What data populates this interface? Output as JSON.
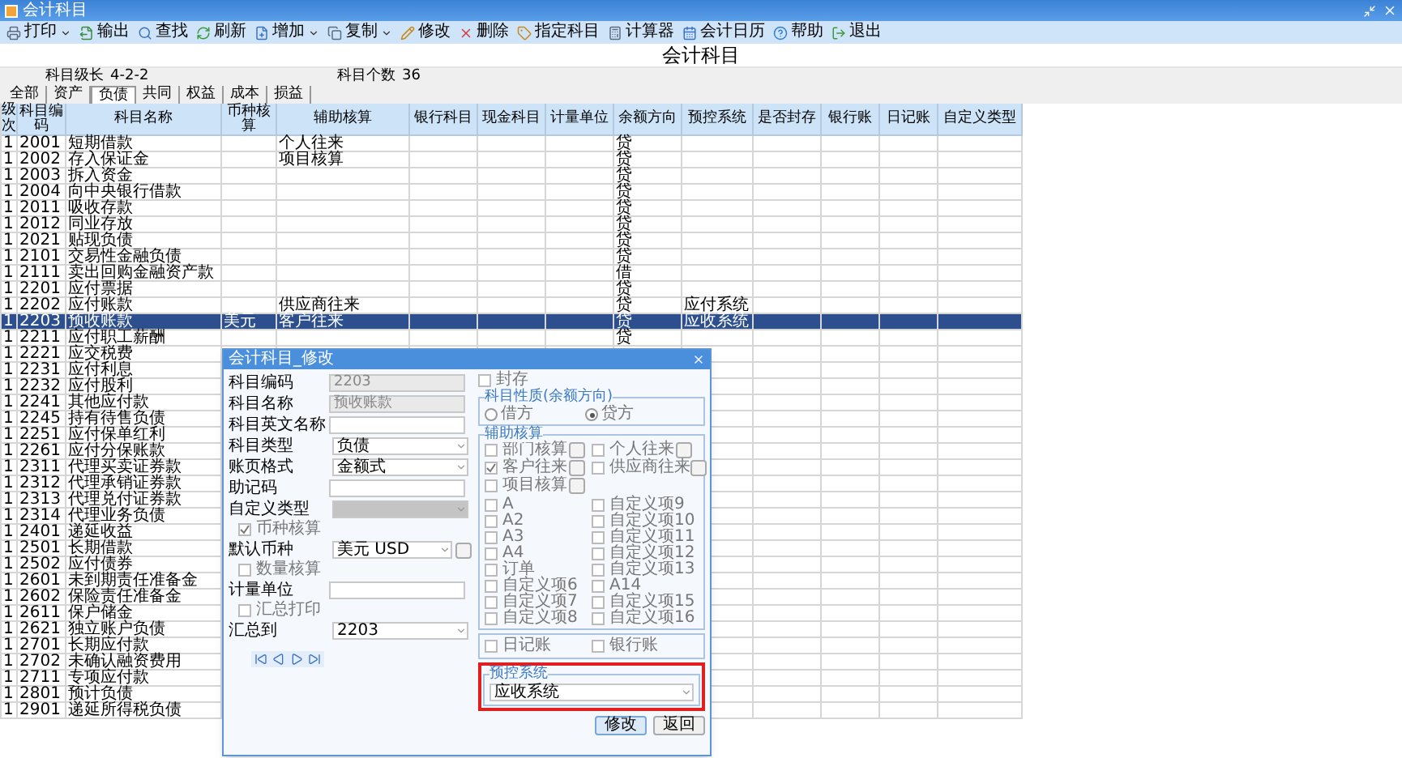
{
  "window": {
    "title": "会计科目"
  },
  "toolbar": [
    {
      "label": "打印",
      "dropdown": true
    },
    {
      "label": "输出",
      "dropdown": false
    },
    {
      "label": "查找",
      "dropdown": false
    },
    {
      "label": "刷新",
      "dropdown": false
    },
    {
      "label": "增加",
      "dropdown": true
    },
    {
      "label": "复制",
      "dropdown": true
    },
    {
      "label": "修改",
      "dropdown": false
    },
    {
      "label": "删除",
      "dropdown": false
    },
    {
      "label": "指定科目",
      "dropdown": false
    },
    {
      "label": "计算器",
      "dropdown": false
    },
    {
      "label": "会计日历",
      "dropdown": false
    },
    {
      "label": "帮助",
      "dropdown": false
    },
    {
      "label": "退出",
      "dropdown": false
    }
  ],
  "heading": "会计科目",
  "info": [
    {
      "label": "科目级长",
      "value": "4-2-2"
    },
    {
      "label": "科目个数",
      "value": "36"
    }
  ],
  "tabs": [
    {
      "label": "全部",
      "selected": false
    },
    {
      "label": "资产",
      "selected": false
    },
    {
      "label": "负债",
      "selected": true
    },
    {
      "label": "共同",
      "selected": false
    },
    {
      "label": "权益",
      "selected": false
    },
    {
      "label": "成本",
      "selected": false
    },
    {
      "label": "损益",
      "selected": false
    }
  ],
  "table": {
    "columns": [
      "级次",
      "科目编码",
      "科目名称",
      "币种核算",
      "辅助核算",
      "银行科目",
      "现金科目",
      "计量单位",
      "余额方向",
      "预控系统",
      "是否封存",
      "银行账",
      "日记账",
      "自定义类型"
    ],
    "rows": [
      {
        "level": "1",
        "code": "2001",
        "name": "短期借款",
        "auxiliary": "个人往来",
        "direction": "贷",
        "selected": false
      },
      {
        "level": "1",
        "code": "2002",
        "name": "存入保证金",
        "auxiliary": "项目核算",
        "direction": "贷",
        "selected": false
      },
      {
        "level": "1",
        "code": "2003",
        "name": "拆入资金",
        "direction": "贷",
        "selected": false
      },
      {
        "level": "1",
        "code": "2004",
        "name": "向中央银行借款",
        "direction": "贷",
        "selected": false
      },
      {
        "level": "1",
        "code": "2011",
        "name": "吸收存款",
        "direction": "贷",
        "selected": false
      },
      {
        "level": "1",
        "code": "2012",
        "name": "同业存放",
        "direction": "贷",
        "selected": false
      },
      {
        "level": "1",
        "code": "2021",
        "name": "贴现负债",
        "direction": "贷",
        "selected": false
      },
      {
        "level": "1",
        "code": "2101",
        "name": "交易性金融负债",
        "direction": "贷",
        "selected": false
      },
      {
        "level": "1",
        "code": "2111",
        "name": "卖出回购金融资产款",
        "direction": "借",
        "selected": false
      },
      {
        "level": "1",
        "code": "2201",
        "name": "应付票据",
        "direction": "贷",
        "selected": false
      },
      {
        "level": "1",
        "code": "2202",
        "name": "应付账款",
        "auxiliary": "供应商往来",
        "direction": "贷",
        "budget_system": "应付系统",
        "selected": false
      },
      {
        "level": "1",
        "code": "2203",
        "name": "预收账款",
        "currency": "美元",
        "auxiliary": "客户往来",
        "direction": "贷",
        "budget_system": "应收系统",
        "selected": true
      },
      {
        "level": "1",
        "code": "2211",
        "name": "应付职工薪酬",
        "direction": "贷",
        "selected": false
      },
      {
        "level": "1",
        "code": "2221",
        "name": "应交税费",
        "selected": false
      },
      {
        "level": "1",
        "code": "2231",
        "name": "应付利息",
        "selected": false
      },
      {
        "level": "1",
        "code": "2232",
        "name": "应付股利",
        "selected": false
      },
      {
        "level": "1",
        "code": "2241",
        "name": "其他应付款",
        "selected": false
      },
      {
        "level": "1",
        "code": "2245",
        "name": "持有待售负债",
        "selected": false
      },
      {
        "level": "1",
        "code": "2251",
        "name": "应付保单红利",
        "selected": false
      },
      {
        "level": "1",
        "code": "2261",
        "name": "应付分保账款",
        "selected": false
      },
      {
        "level": "1",
        "code": "2311",
        "name": "代理买卖证券款",
        "selected": false
      },
      {
        "level": "1",
        "code": "2312",
        "name": "代理承销证券款",
        "selected": false
      },
      {
        "level": "1",
        "code": "2313",
        "name": "代理兑付证券款",
        "selected": false
      },
      {
        "level": "1",
        "code": "2314",
        "name": "代理业务负债",
        "selected": false
      },
      {
        "level": "1",
        "code": "2401",
        "name": "递延收益",
        "selected": false
      },
      {
        "level": "1",
        "code": "2501",
        "name": "长期借款",
        "selected": false
      },
      {
        "level": "1",
        "code": "2502",
        "name": "应付债券",
        "selected": false
      },
      {
        "level": "1",
        "code": "2601",
        "name": "未到期责任准备金",
        "selected": false
      },
      {
        "level": "1",
        "code": "2602",
        "name": "保险责任准备金",
        "selected": false
      },
      {
        "level": "1",
        "code": "2611",
        "name": "保户储金",
        "selected": false
      },
      {
        "level": "1",
        "code": "2621",
        "name": "独立账户负债",
        "selected": false
      },
      {
        "level": "1",
        "code": "2701",
        "name": "长期应付款",
        "selected": false
      },
      {
        "level": "1",
        "code": "2702",
        "name": "未确认融资费用",
        "selected": false
      },
      {
        "level": "1",
        "code": "2711",
        "name": "专项应付款",
        "selected": false
      },
      {
        "level": "1",
        "code": "2801",
        "name": "预计负债",
        "selected": false
      },
      {
        "level": "1",
        "code": "2901",
        "name": "递延所得税负债",
        "selected": false
      }
    ]
  },
  "dialog": {
    "title": "会计科目_修改",
    "fields": [
      {
        "kind": "input",
        "label": "科目编码",
        "value": "2203",
        "disabled": true
      },
      {
        "kind": "input",
        "label": "科目名称",
        "value": "预收账款",
        "disabled": true
      },
      {
        "kind": "input",
        "label": "科目英文名称",
        "disabled": false
      },
      {
        "kind": "select",
        "label": "科目类型",
        "value": "负债",
        "disabled": false
      },
      {
        "kind": "select",
        "label": "账页格式",
        "value": "金额式",
        "disabled": false
      },
      {
        "kind": "input",
        "label": "助记码",
        "disabled": false
      },
      {
        "kind": "select",
        "label": "自定义类型",
        "disabled": true
      },
      {
        "kind": "check",
        "label": "币种核算",
        "checked": true
      },
      {
        "kind": "select",
        "label": "默认币种",
        "value": "美元 USD",
        "disabled": false,
        "more": true
      },
      {
        "kind": "check",
        "label": "数量核算",
        "checked": false
      },
      {
        "kind": "input",
        "label": "计量单位",
        "disabled": false
      },
      {
        "kind": "check",
        "label": "汇总打印",
        "checked": false
      },
      {
        "kind": "select",
        "label": "汇总到",
        "value": "2203",
        "disabled": false
      }
    ],
    "seal": {
      "label": "封存",
      "checked": false
    },
    "nature": {
      "legend": "科目性质(余额方向)",
      "options": [
        {
          "label": "借方",
          "selected": false
        },
        {
          "label": "贷方",
          "selected": true
        }
      ]
    },
    "auxiliary": {
      "legend": "辅助核算",
      "top_items": [
        {
          "label": "部门核算",
          "checked": false
        },
        {
          "label": "个人往来",
          "checked": false
        },
        {
          "label": "客户往来",
          "checked": true
        },
        {
          "label": "供应商往来",
          "checked": false
        },
        {
          "label": "项目核算",
          "checked": false
        }
      ],
      "items": [
        {
          "label": "A",
          "checked": false
        },
        {
          "label": "自定义项9",
          "checked": false
        },
        {
          "label": "A2",
          "checked": false
        },
        {
          "label": "自定义项10",
          "checked": false
        },
        {
          "label": "A3",
          "checked": false
        },
        {
          "label": "自定义项11",
          "checked": false
        },
        {
          "label": "A4",
          "checked": false
        },
        {
          "label": "自定义项12",
          "checked": false
        },
        {
          "label": "订单",
          "checked": false
        },
        {
          "label": "自定义项13",
          "checked": false
        },
        {
          "label": "自定义项6",
          "checked": false
        },
        {
          "label": "A14",
          "checked": false
        },
        {
          "label": "自定义项7",
          "checked": false
        },
        {
          "label": "自定义项15",
          "checked": false
        },
        {
          "label": "自定义项8",
          "checked": false
        },
        {
          "label": "自定义项16",
          "checked": false
        }
      ]
    },
    "ledgers": [
      {
        "label": "日记账",
        "checked": false
      },
      {
        "label": "银行账",
        "checked": false
      }
    ],
    "budget": {
      "legend": "预控系统",
      "value": "应收系统",
      "highlighted": true
    },
    "buttons": [
      {
        "label": "修改",
        "kind": "primary"
      },
      {
        "label": "返回",
        "kind": "plain"
      }
    ]
  }
}
